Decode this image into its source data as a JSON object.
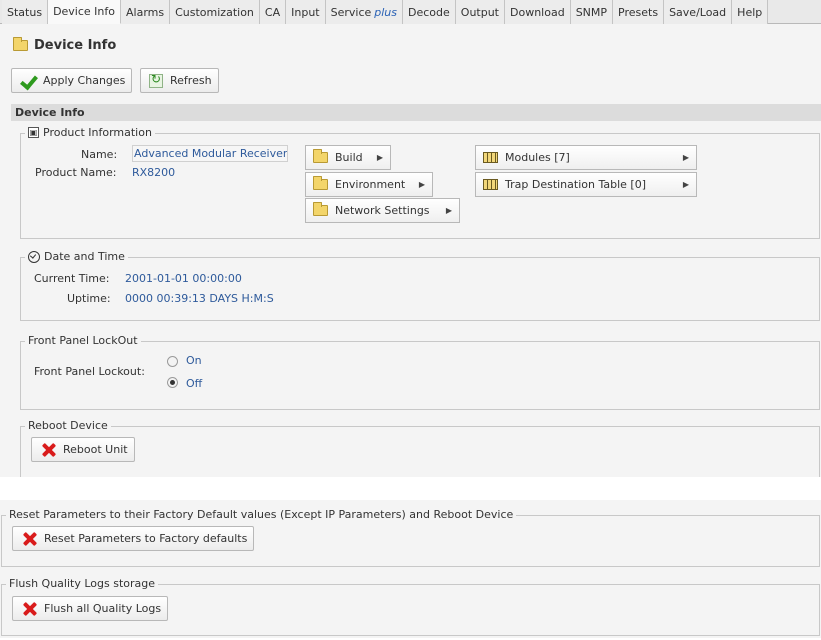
{
  "tabs": [
    {
      "label": "Status"
    },
    {
      "label": "Device Info",
      "active": true
    },
    {
      "label": "Alarms"
    },
    {
      "label": "Customization"
    },
    {
      "label": "CA"
    },
    {
      "label": "Input"
    },
    {
      "label": "Service",
      "suffix": "plus"
    },
    {
      "label": "Decode"
    },
    {
      "label": "Output"
    },
    {
      "label": "Download"
    },
    {
      "label": "SNMP"
    },
    {
      "label": "Presets"
    },
    {
      "label": "Save/Load"
    },
    {
      "label": "Help"
    }
  ],
  "page": {
    "title": "Device Info",
    "apply_label": "Apply Changes",
    "refresh_label": "Refresh",
    "section_header": "Device Info"
  },
  "product": {
    "legend": "Product Information",
    "name_label": "Name:",
    "name_value": "Advanced Modular Receiver",
    "product_name_label": "Product Name:",
    "product_name_value": "RX8200",
    "buttons": {
      "build": "Build",
      "environment": "Environment",
      "network": "Network Settings",
      "modules": "Modules [7]",
      "trap": "Trap Destination Table [0]"
    }
  },
  "datetime": {
    "legend": "Date and Time",
    "current_time_label": "Current Time:",
    "current_time_value": "2001-01-01 00:00:00",
    "uptime_label": "Uptime:",
    "uptime_value": "0000 00:39:13 DAYS H:M:S"
  },
  "lockout": {
    "legend": "Front Panel LockOut",
    "label": "Front Panel Lockout:",
    "options": [
      "On",
      "Off"
    ],
    "selected": "Off"
  },
  "reboot": {
    "legend": "Reboot Device",
    "button": "Reboot Unit"
  },
  "reset": {
    "legend": "Reset Parameters to their Factory Default values (Except IP Parameters) and Reboot Device",
    "button": "Reset Parameters to Factory defaults"
  },
  "flush": {
    "legend": "Flush Quality Logs storage",
    "button": "Flush all Quality Logs"
  }
}
